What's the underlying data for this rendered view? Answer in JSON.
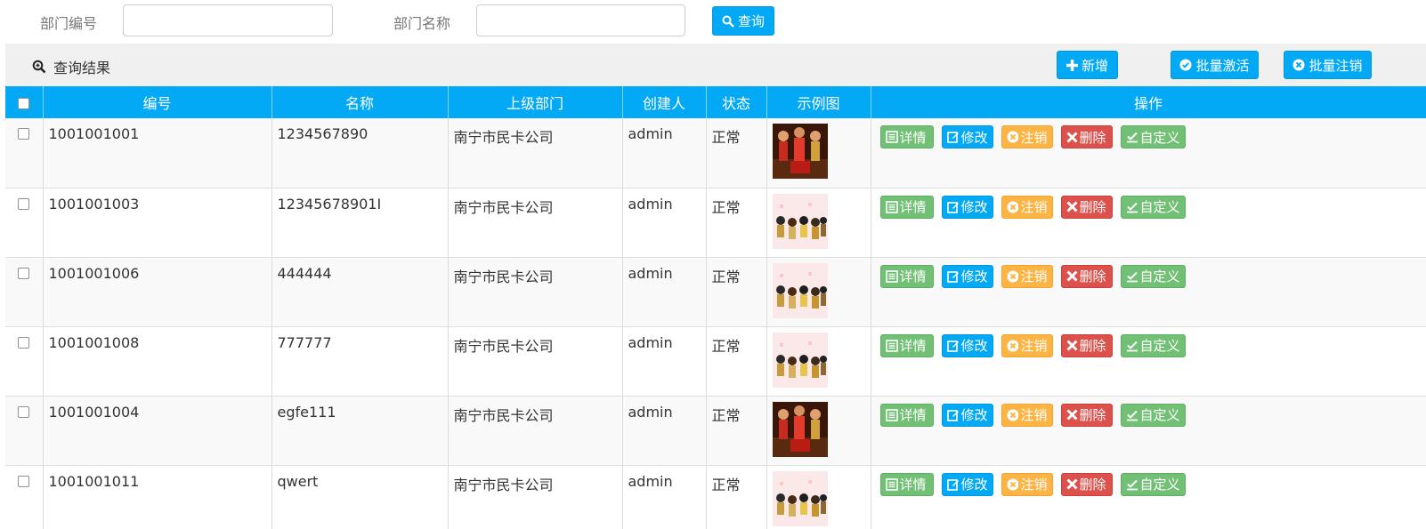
{
  "search": {
    "dept_code_label": "部门编号",
    "dept_code_value": "",
    "dept_name_label": "部门名称",
    "dept_name_value": "",
    "query_button": "查询"
  },
  "results": {
    "title": "查询结果",
    "add_button": "新增",
    "batch_activate_button": "批量激活",
    "batch_cancel_button": "批量注销"
  },
  "table": {
    "headers": [
      "编号",
      "名称",
      "上级部门",
      "创建人",
      "状态",
      "示例图",
      "操作"
    ],
    "actions": [
      "详情",
      "修改",
      "注销",
      "删除",
      "自定义"
    ],
    "rows": [
      {
        "code": "1001001001",
        "name": "1234567890",
        "parent": "南宁市民卡公司",
        "creator": "admin",
        "status": "正常",
        "image": "dark-group-photo"
      },
      {
        "code": "1001001003",
        "name": "12345678901I",
        "parent": "南宁市民卡公司",
        "creator": "admin",
        "status": "正常",
        "image": "cartoon-group-photo"
      },
      {
        "code": "1001001006",
        "name": "444444",
        "parent": "南宁市民卡公司",
        "creator": "admin",
        "status": "正常",
        "image": "cartoon-group-photo"
      },
      {
        "code": "1001001008",
        "name": "777777",
        "parent": "南宁市民卡公司",
        "creator": "admin",
        "status": "正常",
        "image": "cartoon-group-photo"
      },
      {
        "code": "1001001004",
        "name": "egfe111",
        "parent": "南宁市民卡公司",
        "creator": "admin",
        "status": "正常",
        "image": "dark-group-photo"
      },
      {
        "code": "1001001011",
        "name": "qwert",
        "parent": "南宁市民卡公司",
        "creator": "admin",
        "status": "正常",
        "image": "cartoon-group-photo"
      }
    ]
  },
  "colors": {
    "primary": "#03a9f4",
    "success": "#72c075",
    "warning": "#fcb544",
    "danger": "#dd514c"
  }
}
